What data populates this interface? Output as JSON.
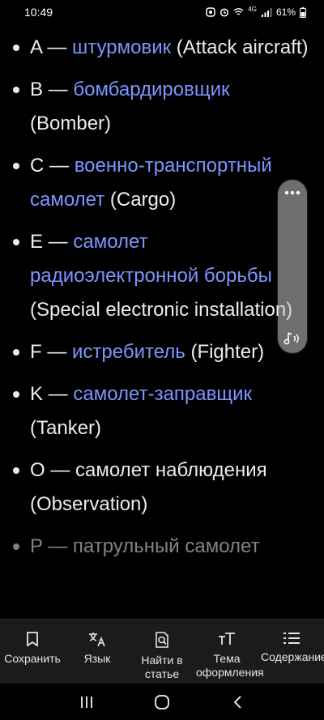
{
  "status": {
    "time": "10:49",
    "network": "4G",
    "battery": "61%"
  },
  "items": [
    {
      "letter": "A",
      "dash": " — ",
      "link": "штурмовик",
      "trail": " (Attack aircraft)"
    },
    {
      "letter": "B",
      "dash": " — ",
      "link": "бомбардировщик",
      "trail": " (Bomber)"
    },
    {
      "letter": "C",
      "dash": " — ",
      "link_line1": "военно-транспортный",
      "link_line2": "самолет",
      "trail": " (Cargo)"
    },
    {
      "letter": "E",
      "dash": " — ",
      "link_line1": "самолет",
      "link_line2": "радиоэлектронной борьбы",
      "trail": "(Special electronic installation)"
    },
    {
      "letter": "F",
      "dash": " — ",
      "link": "истребитель",
      "trail": " (Fighter)"
    },
    {
      "letter": "K",
      "dash": " — ",
      "link": "самолет-заправщик",
      "trail": " (Tanker)"
    },
    {
      "letter": "O",
      "dash": " — ",
      "text": "самолет наблюдения",
      "trail": "(Observation)"
    },
    {
      "letter": "P",
      "dash": " — ",
      "text": "патрульный самолет"
    }
  ],
  "toolbar": [
    {
      "label": "Сохранить",
      "icon": "bookmark-icon"
    },
    {
      "label": "Язык",
      "icon": "translate-icon"
    },
    {
      "label": "Найти в статье",
      "icon": "find-in-page-icon"
    },
    {
      "label": "Тема оформления",
      "icon": "text-size-icon"
    },
    {
      "label": "Содержание",
      "icon": "list-icon"
    }
  ]
}
